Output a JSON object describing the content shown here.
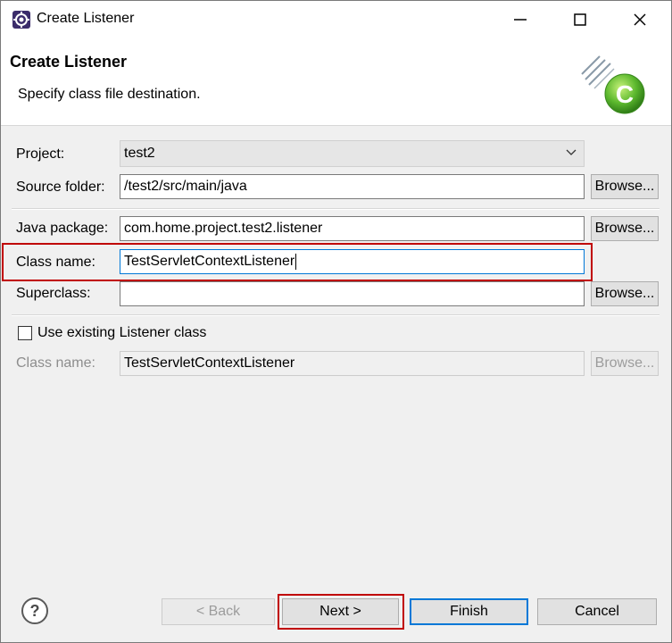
{
  "window": {
    "title": "Create Listener",
    "icon": "eclipse-gear-icon",
    "controls": {
      "minimize": "minimize-icon",
      "maximize": "maximize-icon",
      "close": "close-icon"
    }
  },
  "banner": {
    "title": "Create Listener",
    "description": "Specify class file destination.",
    "graphic": "new-class-wizard-icon"
  },
  "form": {
    "project": {
      "label": "Project:",
      "value": "test2"
    },
    "source_folder": {
      "label": "Source folder:",
      "value": "/test2/src/main/java",
      "browse": "Browse..."
    },
    "java_package": {
      "label": "Java package:",
      "value": "com.home.project.test2.listener",
      "browse": "Browse..."
    },
    "class_name": {
      "label": "Class name:",
      "value": "TestServletContextListener"
    },
    "superclass": {
      "label": "Superclass:",
      "value": "",
      "browse": "Browse..."
    },
    "use_existing": {
      "label": "Use existing Listener class",
      "checked": false
    },
    "existing_class_name": {
      "label": "Class name:",
      "value": "TestServletContextListener",
      "browse": "Browse..."
    }
  },
  "footer": {
    "help_icon": "help-icon",
    "back": "< Back",
    "next": "Next >",
    "finish": "Finish",
    "cancel": "Cancel"
  },
  "colors": {
    "highlight": "#c00000",
    "focus": "#0078d7",
    "dialog_bg": "#f0f0f0"
  }
}
